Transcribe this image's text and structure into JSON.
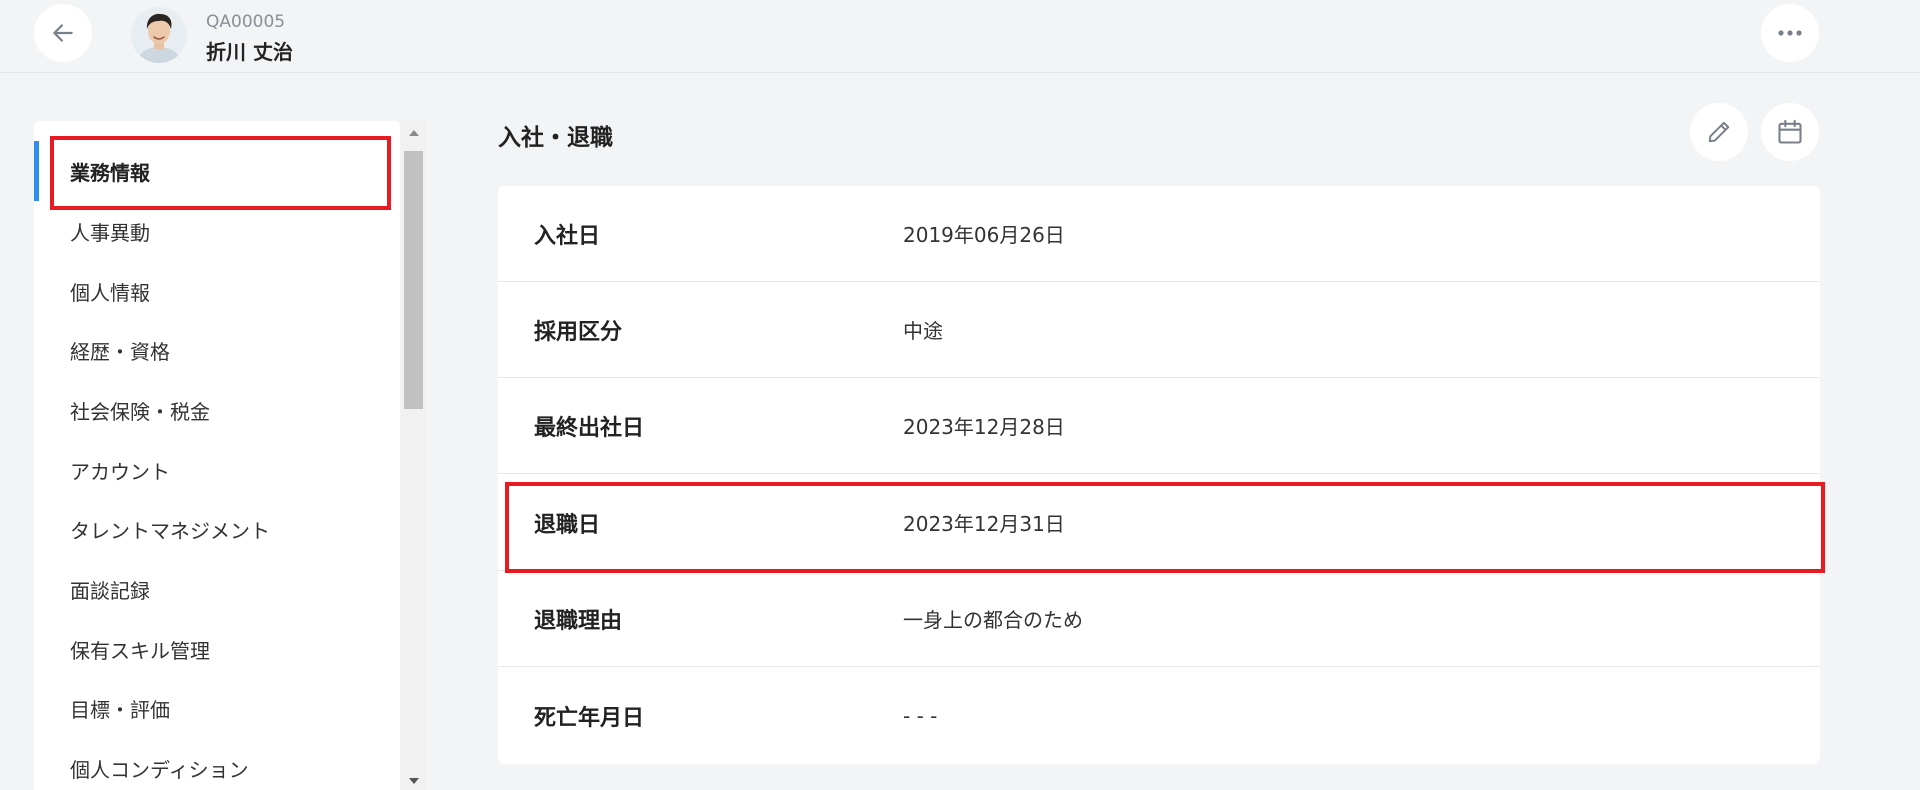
{
  "header": {
    "employee_code": "QA00005",
    "employee_name": "折川 丈治",
    "back_icon": "arrow-left-icon",
    "more_icon": "more-horizontal-icon"
  },
  "sidebar": {
    "items": [
      {
        "label": "業務情報",
        "active": true
      },
      {
        "label": "人事異動"
      },
      {
        "label": "個人情報"
      },
      {
        "label": "経歴・資格"
      },
      {
        "label": "社会保険・税金"
      },
      {
        "label": "アカウント"
      },
      {
        "label": "タレントマネジメント"
      },
      {
        "label": "面談記録"
      },
      {
        "label": "保有スキル管理"
      },
      {
        "label": "目標・評価"
      },
      {
        "label": "個人コンディション"
      }
    ]
  },
  "section": {
    "title": "入社・退職",
    "edit_icon": "pencil-icon",
    "calendar_icon": "calendar-icon"
  },
  "rows": [
    {
      "label": "入社日",
      "value": "2019年06月26日"
    },
    {
      "label": "採用区分",
      "value": "中途"
    },
    {
      "label": "最終出社日",
      "value": "2023年12月28日"
    },
    {
      "label": "退職日",
      "value": "2023年12月31日"
    },
    {
      "label": "退職理由",
      "value": "一身上の都合のため"
    },
    {
      "label": "死亡年月日",
      "value": "- - -"
    }
  ],
  "colors": {
    "accent": "#2f8ff0",
    "highlight": "#e81b23",
    "background": "#f3f4f6"
  }
}
